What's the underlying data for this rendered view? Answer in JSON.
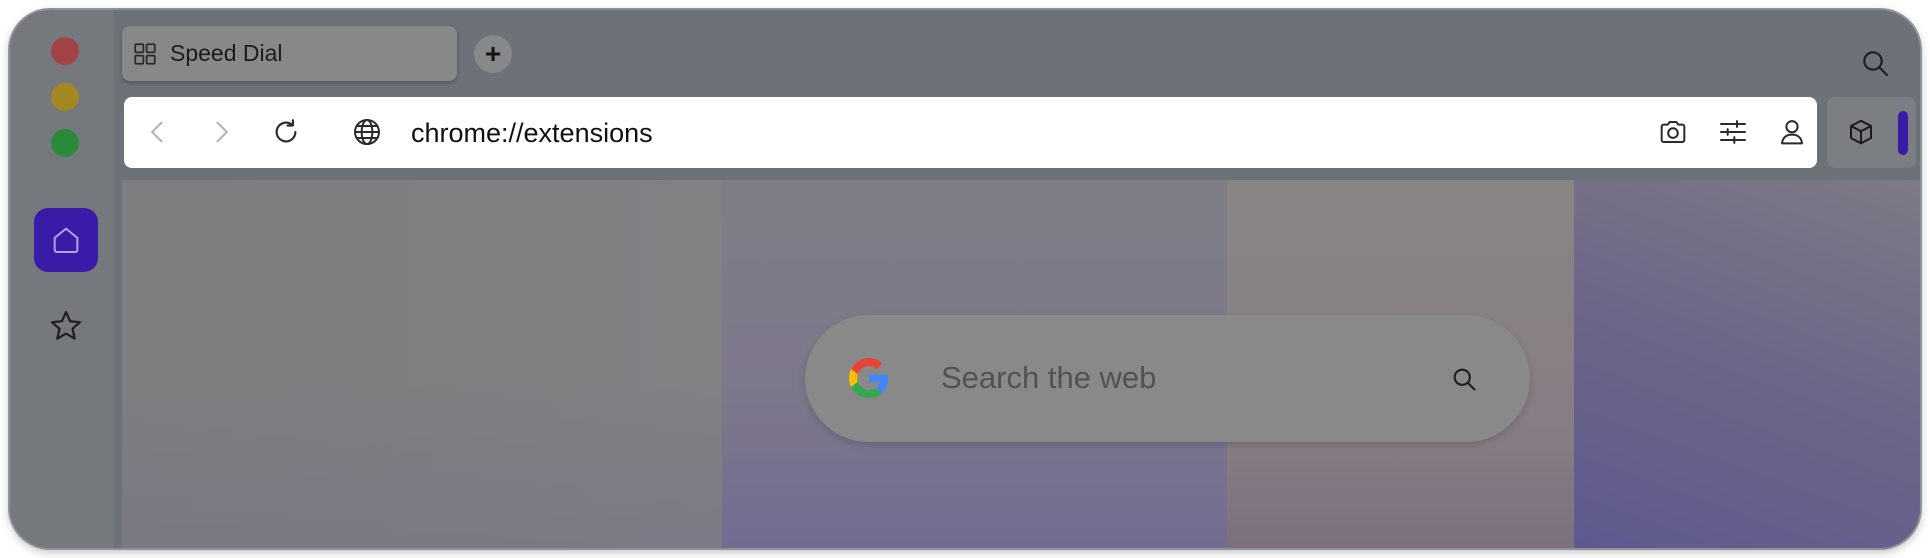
{
  "tab": {
    "label": "Speed Dial",
    "icon": "speed-dial-grid-icon"
  },
  "toolbar": {
    "new_tab_label": "+",
    "url": "chrome://extensions"
  },
  "search": {
    "placeholder": "Search the web",
    "engine_icon": "google-g-icon"
  },
  "colors": {
    "accent": "#3a1ba8",
    "traffic_red": "#a34346",
    "traffic_yellow": "#a48722",
    "traffic_green": "#2a8a3c"
  },
  "icons": {
    "back": "back-arrow-icon",
    "forward": "forward-arrow-icon",
    "reload": "reload-icon",
    "site": "globe-icon",
    "snapshot": "camera-icon",
    "settings": "sliders-icon",
    "profile": "profile-icon",
    "extensions": "cube-icon",
    "sidebar_home": "home-icon",
    "sidebar_bookmarks": "star-icon",
    "tab_search": "search-icon"
  }
}
